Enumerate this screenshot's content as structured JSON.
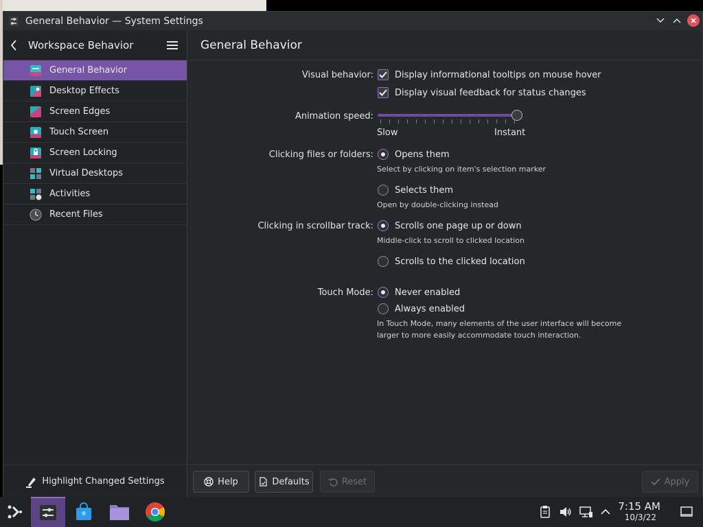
{
  "window": {
    "title": "General Behavior — System Settings"
  },
  "sidebar": {
    "title": "Workspace Behavior",
    "items": [
      {
        "label": "General Behavior",
        "active": true
      },
      {
        "label": "Desktop Effects"
      },
      {
        "label": "Screen Edges"
      },
      {
        "label": "Touch Screen"
      },
      {
        "label": "Screen Locking"
      },
      {
        "label": "Virtual Desktops"
      },
      {
        "label": "Activities"
      },
      {
        "label": "Recent Files"
      }
    ],
    "footer_label": "Highlight Changed Settings"
  },
  "main": {
    "title": "General Behavior",
    "visual_behavior": {
      "label": "Visual behavior:",
      "tooltips": "Display informational tooltips on mouse hover",
      "feedback": "Display visual feedback for status changes"
    },
    "animation": {
      "label": "Animation speed:",
      "min_label": "Slow",
      "max_label": "Instant",
      "value_fraction": 1.0
    },
    "clicking_files": {
      "label": "Clicking files or folders:",
      "opt1": "Opens them",
      "opt1_note": "Select by clicking on item's selection marker",
      "opt2": "Selects them",
      "opt2_note": "Open by double-clicking instead"
    },
    "scrollbar": {
      "label": "Clicking in scrollbar track:",
      "opt1": "Scrolls one page up or down",
      "opt1_note": "Middle-click to scroll to clicked location",
      "opt2": "Scrolls to the clicked location"
    },
    "touch": {
      "label": "Touch Mode:",
      "opt1": "Never enabled",
      "opt2": "Always enabled",
      "note1": "In Touch Mode, many elements of the user interface will become",
      "note2": "larger to more easily accommodate touch interaction."
    },
    "buttons": {
      "help": "Help",
      "defaults": "Defaults",
      "reset": "Reset",
      "apply": "Apply"
    }
  },
  "taskbar": {
    "time": "7:15 AM",
    "date": "10/3/22"
  },
  "colors": {
    "accent": "#7654a6",
    "window_bg": "#25272b",
    "sidebar_bg": "#222327",
    "close": "#e2505b"
  }
}
